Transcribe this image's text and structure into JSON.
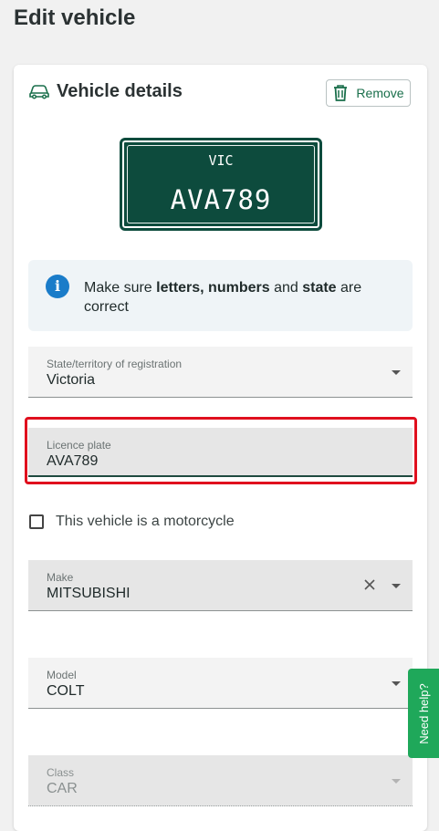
{
  "page": {
    "title": "Edit vehicle"
  },
  "card": {
    "title": "Vehicle details",
    "remove_label": "Remove"
  },
  "plate": {
    "state": "VIC",
    "number": "AVA789"
  },
  "info": {
    "prefix": "Make sure ",
    "bold1": "letters, numbers",
    "mid1": " and ",
    "bold2": "state",
    "suffix": " are correct"
  },
  "fields": {
    "state": {
      "label": "State/territory of registration",
      "value": "Victoria"
    },
    "licence": {
      "label": "Licence plate",
      "value": "AVA789"
    },
    "make": {
      "label": "Make",
      "value": "MITSUBISHI"
    },
    "model": {
      "label": "Model",
      "value": "COLT"
    },
    "class": {
      "label": "Class",
      "value": "CAR"
    }
  },
  "motorcycle": {
    "label": "This vehicle is a motorcycle",
    "checked": false
  },
  "help": {
    "label": "Need help?"
  },
  "colors": {
    "accent": "#1a6f4b",
    "plate_bg": "#0d4b3d",
    "info_icon": "#1a7cc9",
    "highlight": "#e0101e",
    "help_bg": "#1fa85a"
  }
}
